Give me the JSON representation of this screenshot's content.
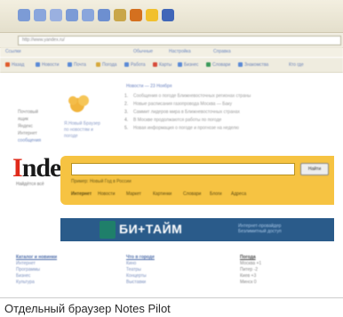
{
  "caption": "Отдельный браузер Notes Pilot",
  "browser": {
    "address_url": "http://www.yandex.ru/",
    "toolbar_icons": [
      "back-icon",
      "forward-icon",
      "stop-icon",
      "refresh-icon",
      "home-icon",
      "search-icon",
      "favorites-icon",
      "history-icon",
      "mail-icon",
      "save-icon"
    ],
    "links_bar": [
      "Ссылки",
      "Обычные",
      "Настройка",
      "Справка"
    ],
    "resource_bar": [
      "Назад",
      "Новости",
      "Почта",
      "Погода",
      "Работа",
      "Карты",
      "Бизнес",
      "Словари",
      "Знакомства",
      "Кто где"
    ]
  },
  "page": {
    "sidebar_lines": [
      "Почтовый",
      "ящик",
      "Яндекс",
      "Интернет",
      "сообщения"
    ],
    "promo_lines": [
      "Я.Новый Браузер",
      "по новостям и",
      "погоде"
    ],
    "news_head": "Новости — 23 Ноября",
    "news_items": [
      {
        "num": "1.",
        "text": "Сообщения о погоде Ближневосточных регионах страны"
      },
      {
        "num": "2.",
        "text": "Новые расписания газопровода Москва — Баку"
      },
      {
        "num": "3.",
        "text": "Саммит лидеров мира в Ближневосточных странах"
      },
      {
        "num": "4.",
        "text": "В Москве продолжаются работы по погоде"
      },
      {
        "num": "5.",
        "text": "Новая информация о погоде и прогнозе на неделю"
      }
    ],
    "logo_first": "I",
    "logo_rest": "ndex",
    "logo_sub": "Найдётся всё",
    "search_button": "Найти",
    "search_options": "Пример: Новый Год в России",
    "search_tabs": [
      "Интернет",
      "Новости",
      "Маркет",
      "Картинки",
      "Словари",
      "Блоги",
      "Адреса"
    ],
    "banner_text": "БИ+ТАЙМ",
    "banner_right": [
      "Интернет-провайдер",
      "Безлимитный доступ"
    ],
    "columns": [
      {
        "head": "Каталог и новинки",
        "lines": [
          "Интернет",
          "Программы",
          "Бизнес",
          "Культура"
        ]
      },
      {
        "head": "Что в городе",
        "lines": [
          "Кино",
          "Театры",
          "Концерты",
          "Выставки"
        ]
      },
      {
        "head": "Погода",
        "lines": [
          "Москва +1",
          "Питер -2",
          "Киев +3",
          "Минск 0"
        ]
      }
    ]
  },
  "colors": {
    "accent_search": "#f6c342",
    "banner": "#2a5b8a",
    "logo_red": "#e02a1a"
  }
}
